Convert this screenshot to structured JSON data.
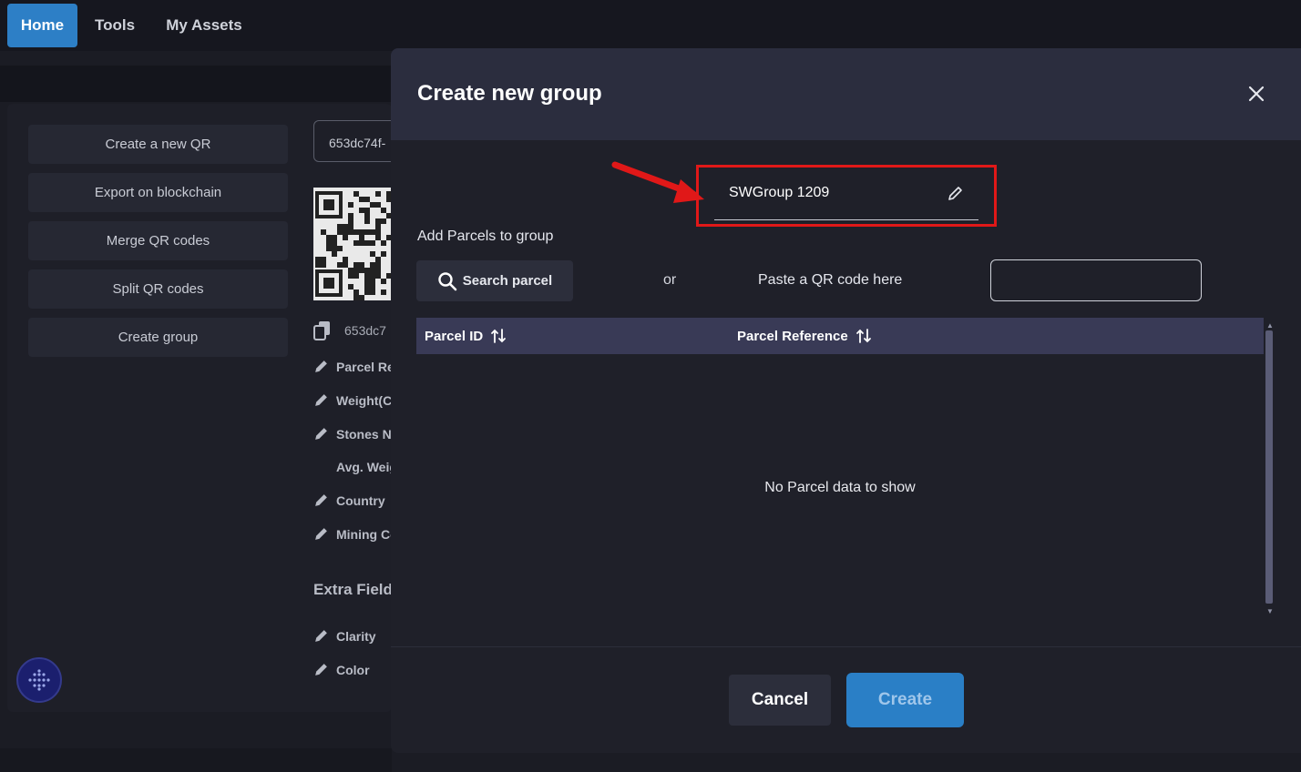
{
  "nav": {
    "home": "Home",
    "tools": "Tools",
    "assets": "My Assets"
  },
  "sidebar": {
    "items": [
      {
        "label": "Create a new QR"
      },
      {
        "label": "Export on blockchain"
      },
      {
        "label": "Merge QR codes"
      },
      {
        "label": "Split QR codes"
      },
      {
        "label": "Create group"
      }
    ]
  },
  "details": {
    "qr_id_short": "653dc74f-",
    "copy_id": "653dc7",
    "fields": [
      "Parcel Re",
      "Weight(C",
      "Stones N",
      "Avg. Weig",
      "Country",
      "Mining Co"
    ],
    "extra_title": "Extra Field",
    "extra_fields": [
      "Clarity",
      "Color"
    ]
  },
  "modal": {
    "title": "Create new group",
    "group_name": "SWGroup 1209",
    "add_label": "Add Parcels to group",
    "search_label": "Search parcel",
    "or_label": "or",
    "paste_label": "Paste a QR code here",
    "columns": [
      "Parcel ID",
      "Parcel Reference"
    ],
    "empty_message": "No Parcel data to show",
    "cancel_label": "Cancel",
    "create_label": "Create"
  },
  "colors": {
    "accent": "#2d7fc6",
    "highlight": "#e01818",
    "table_header": "#393a56"
  },
  "icons": [
    "search-icon",
    "pencil-icon",
    "close-icon",
    "sort-icon",
    "copy-icon",
    "app-logo-icon"
  ]
}
